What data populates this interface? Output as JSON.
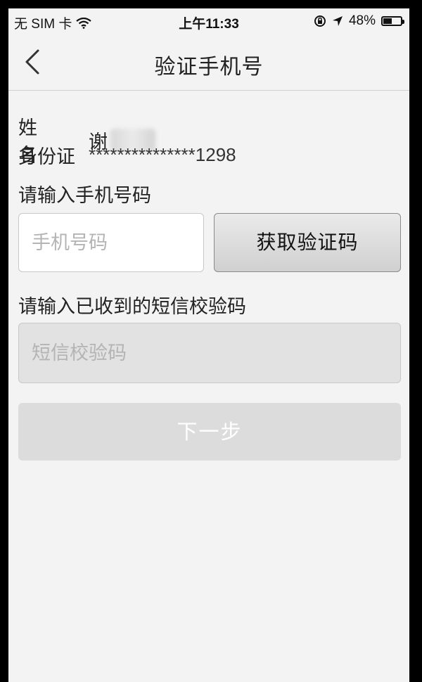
{
  "status_bar": {
    "carrier": "无 SIM 卡",
    "time": "上午11:33",
    "battery_text": "48%",
    "battery_level": 0.48,
    "icons": [
      "wifi-icon",
      "rotation-lock-icon",
      "location-icon",
      "battery-icon"
    ]
  },
  "nav": {
    "back_icon": "chevron-left-icon",
    "title": "验证手机号"
  },
  "user_info": {
    "name_label": "姓名",
    "name_value": "谢",
    "id_label": "身份证",
    "id_value": "***************1298"
  },
  "phone_section": {
    "label": "请输入手机号码",
    "input_value": "",
    "input_placeholder": "手机号码",
    "get_code_label": "获取验证码"
  },
  "sms_section": {
    "label": "请输入已收到的短信校验码",
    "input_value": "",
    "input_placeholder": "短信校验码"
  },
  "next_button_label": "下一步",
  "colors": {
    "background": "#f3f3f3",
    "disabled_button": "#dcdcdc",
    "text": "#222222",
    "placeholder": "#b4b4b4"
  }
}
